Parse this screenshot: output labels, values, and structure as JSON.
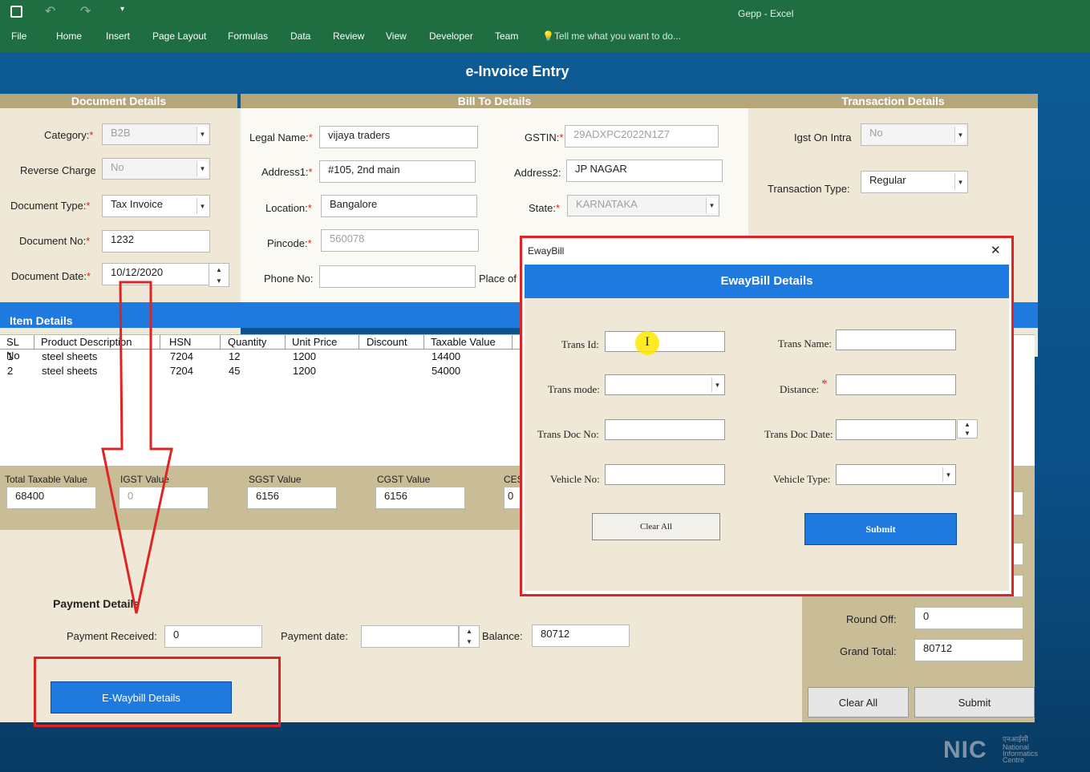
{
  "excel": {
    "title": "Gepp - Excel",
    "menu": [
      "File",
      "Home",
      "Insert",
      "Page Layout",
      "Formulas",
      "Data",
      "Review",
      "View",
      "Developer",
      "Team"
    ],
    "tell_me": "Tell me what you want to do..."
  },
  "form": {
    "title": "e-Invoice Entry",
    "sections": {
      "document": "Document Details",
      "bill_to": "Bill To Details",
      "transaction": "Transaction Details",
      "items": "Item Details",
      "payment": "Payment Details"
    },
    "document": {
      "category_label": "Category:",
      "category": "B2B",
      "reverse_label": "Reverse Charge",
      "reverse": "No",
      "doctype_label": "Document Type:",
      "doctype": "Tax Invoice",
      "docno_label": "Document No:",
      "docno": "1232",
      "docdate_label": "Document Date:",
      "docdate": "10/12/2020"
    },
    "bill_to": {
      "legal_label": "Legal Name:",
      "legal": "vijaya traders",
      "gstin_label": "GSTIN:",
      "gstin": "29ADXPC2022N1Z7",
      "address1_label": "Address1:",
      "address1": "#105, 2nd main",
      "address2_label": "Address2:",
      "address2": "JP NAGAR",
      "location_label": "Location:",
      "location": "Bangalore",
      "state_label": "State:",
      "state": "KARNATAKA",
      "pincode_label": "Pincode:",
      "pincode": "560078",
      "phone_label": "Phone No:",
      "phone": "",
      "place_label": "Place of"
    },
    "transaction": {
      "igst_label": "Igst On Intra",
      "igst": "No",
      "type_label": "Transaction Type:",
      "type": "Regular"
    },
    "items": {
      "columns": [
        "SL No",
        "Product Description",
        "HSN",
        "Quantity",
        "Unit Price",
        "Discount",
        "Taxable Value"
      ],
      "rows": [
        [
          "1",
          "steel sheets",
          "7204",
          "12",
          "1200",
          "",
          "14400"
        ],
        [
          "2",
          "steel sheets",
          "7204",
          "45",
          "1200",
          "",
          "54000"
        ]
      ]
    },
    "totals": {
      "taxable_label": "Total Taxable Value",
      "taxable": "68400",
      "igst_label": "IGST Value",
      "igst": "0",
      "sgst_label": "SGST Value",
      "sgst": "6156",
      "cgst_label": "CGST Value",
      "cgst": "6156",
      "cess_label": "CES",
      "cess": "0"
    },
    "payment": {
      "received_label": "Payment Received:",
      "received": "0",
      "date_label": "Payment date:",
      "date": "",
      "balance_label": "Balance:",
      "balance": "80712"
    },
    "summary": {
      "roundoff_label": "Round Off:",
      "roundoff": "0",
      "grand_label": "Grand Total:",
      "grand": "80712"
    },
    "buttons": {
      "ewaybill": "E-Waybill Details",
      "clear_all": "Clear All",
      "submit": "Submit"
    },
    "logo": {
      "name": "NIC",
      "line1": "National",
      "line2": "Informatics",
      "line3": "Centre",
      "hindi": "एनआईसी"
    }
  },
  "dialog": {
    "window_title": "EwayBill",
    "header": "EwayBill Details",
    "close": "✕",
    "fields": {
      "trans_id": "Trans Id:",
      "trans_name": "Trans Name:",
      "trans_mode": "Trans mode:",
      "distance": "Distance:",
      "trans_doc_no": "Trans Doc No:",
      "trans_doc_date": "Trans Doc Date:",
      "vehicle_no": "Vehicle No:",
      "vehicle_type": "Vehicle Type:"
    },
    "buttons": {
      "clear_all": "Clear All",
      "submit": "Submit"
    }
  },
  "colors": {
    "ribbon": "#1e6e42",
    "stage": "#0b4f86",
    "panel": "#efe8d6",
    "section_bar": "#b5a77a",
    "accent": "#1f7ae0",
    "highlight": "#e02424"
  }
}
